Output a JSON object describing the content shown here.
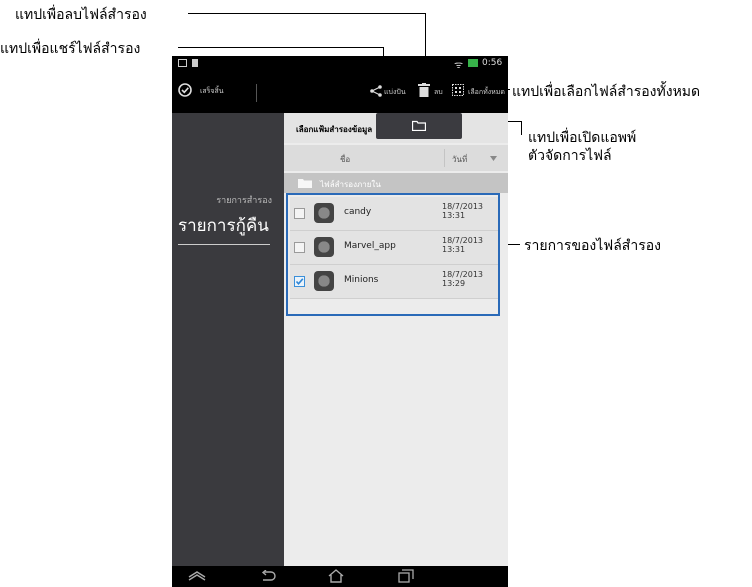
{
  "annotations": {
    "delete": "แทปเพื่อลบไฟล์สำรอง",
    "share": "แทปเพื่อแชร์ไฟล์สำรอง",
    "select_all": "แทปเพื่อเลือกไฟล์สำรองทั้งหมด",
    "open_file_manager_line1": "แทปเพื่อเปิดแอพพ์",
    "open_file_manager_line2": "ตัวจัดการไฟล์",
    "backup_list": "รายการของไฟล์สำรอง"
  },
  "status": {
    "time": "0:56"
  },
  "actionbar": {
    "done_label": "เสร็จสิ้น",
    "share_label": "แบ่งปัน",
    "delete_label": "ลบ",
    "select_all_label": "เลือกทั้งหมด"
  },
  "sidebar": {
    "backup_list_label": "รายการสำรอง",
    "restore_list_label": "รายการกู้คืน"
  },
  "main": {
    "select_folder_label": "เลือกแฟ้มสำรองข้อมูล",
    "col_name": "ชื่อ",
    "col_date": "วันที่",
    "folder_label": "ไฟล์สำรองภายใน"
  },
  "rows": [
    {
      "name": "candy",
      "date": "18/7/2013",
      "time": "13:31",
      "checked": false
    },
    {
      "name": "Marvel_app",
      "date": "18/7/2013",
      "time": "13:31",
      "checked": false
    },
    {
      "name": "Minions",
      "date": "18/7/2013",
      "time": "13:29",
      "checked": true
    }
  ]
}
